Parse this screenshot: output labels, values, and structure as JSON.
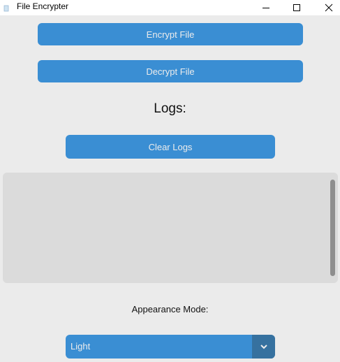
{
  "window": {
    "title": "File Encrypter",
    "icons": {
      "app": "app-icon",
      "minimize": "minimize-icon",
      "maximize": "maximize-icon",
      "close": "close-icon"
    }
  },
  "actions": {
    "encrypt_label": "Encrypt File",
    "decrypt_label": "Decrypt File"
  },
  "logs": {
    "title": "Logs:",
    "clear_label": "Clear Logs",
    "content": ""
  },
  "appearance": {
    "label": "Appearance Mode:",
    "selected": "Light",
    "dropdown_icon": "chevron-down-icon"
  },
  "colors": {
    "button": "#3a8ed3",
    "button_text": "#ececec",
    "dropdown_arrow_bg": "#36719f",
    "background": "#ebebeb",
    "log_bg": "#dbdbdb"
  }
}
